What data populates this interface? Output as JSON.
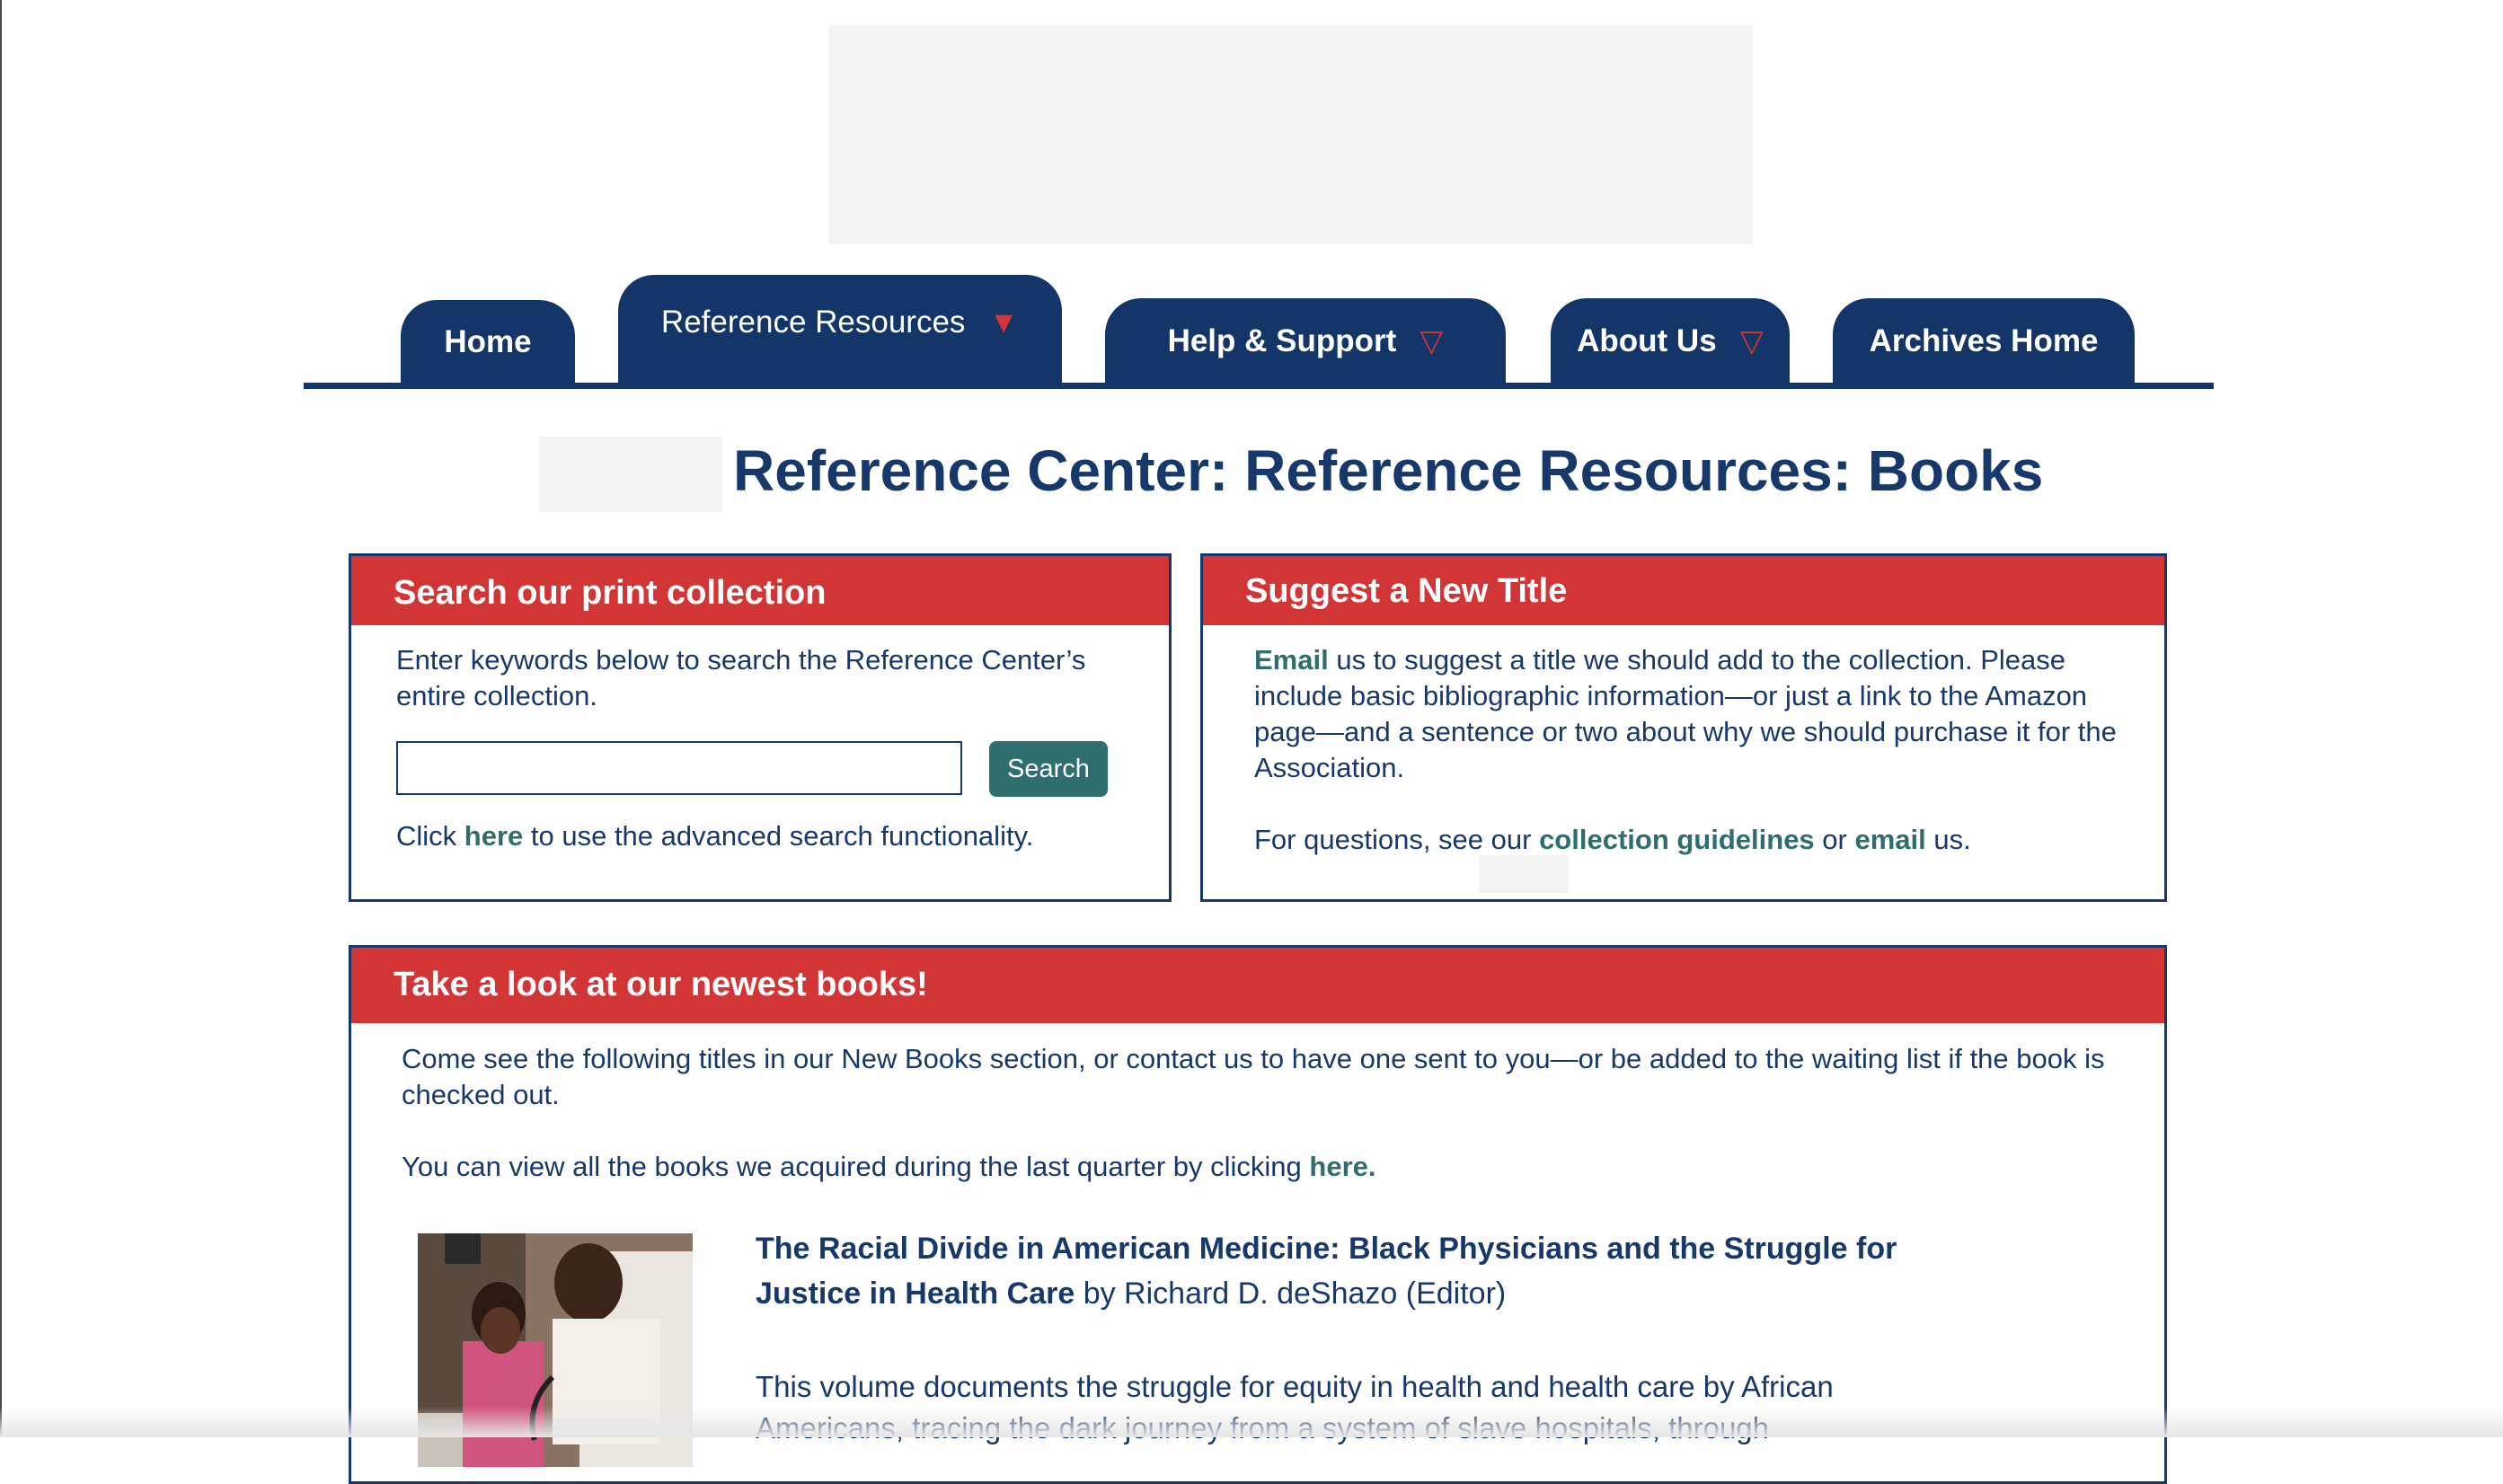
{
  "nav": {
    "home": "Home",
    "reference_resources": "Reference Resources",
    "help_support": "Help & Support",
    "about_us": "About Us",
    "archives_home": "Archives Home",
    "dropdown_arrow": "▽"
  },
  "page": {
    "title": "Reference Center: Reference Resources: Books"
  },
  "search_panel": {
    "heading": "Search our print collection",
    "intro": "Enter keywords below to search the Reference Center’s entire collection.",
    "input_value": "",
    "button_label": "Search",
    "advanced_prefix": "Click ",
    "advanced_link": "here",
    "advanced_suffix": " to use the advanced search functionality."
  },
  "suggest_panel": {
    "heading": "Suggest a New Title",
    "email_link": "Email",
    "body": " us to suggest a title we should add to the collection. Please include basic bibliographic information—or just a link to the Amazon page—and a sentence or two about why we should purchase it for the Association.",
    "questions_prefix": "For questions, see our ",
    "guidelines_link": "collection guidelines",
    "questions_middle": " or ",
    "email_link2": "email",
    "questions_suffix": " us."
  },
  "newest_panel": {
    "heading": "Take a look at our newest books!",
    "intro": "Come see the following titles in our New Books section, or contact us to have one sent to you—or be added to the waiting list if the book is checked out.",
    "quarter_text": "You can view all the books we acquired during the last quarter by clicking ",
    "quarter_link": "here.",
    "book": {
      "title": "The Racial Divide in American Medicine: Black Physicians and the Struggle for Justice in Health Care",
      "byline": " by Richard D. deShazo (Editor)",
      "description": "This volume documents the struggle for equity in health and health care by African Americans, tracing the dark journey from a system of slave hospitals, through"
    }
  },
  "colors": {
    "navy": "#143567",
    "red": "#d23535",
    "teal": "#2e6e6e"
  }
}
